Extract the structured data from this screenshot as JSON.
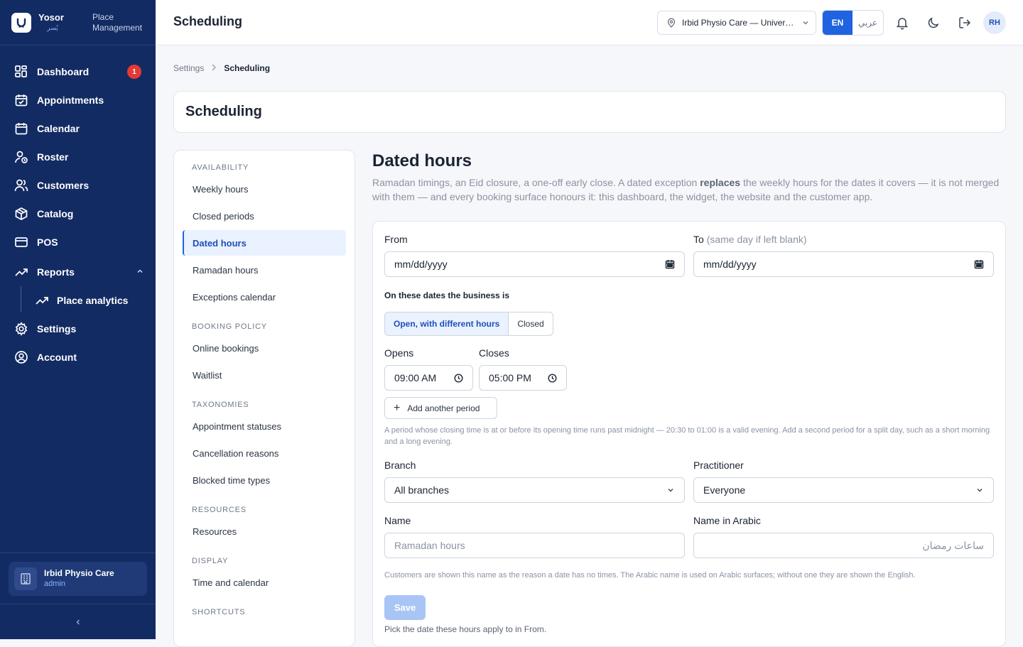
{
  "brand": {
    "name": "Yosor",
    "name_ar": "يُسر",
    "subtitle_line1": "Place",
    "subtitle_line2": "Management"
  },
  "nav": {
    "dashboard": "Dashboard",
    "dashboard_badge": "1",
    "appointments": "Appointments",
    "calendar": "Calendar",
    "roster": "Roster",
    "customers": "Customers",
    "catalog": "Catalog",
    "pos": "POS",
    "reports": "Reports",
    "place_analytics": "Place analytics",
    "settings": "Settings",
    "account": "Account"
  },
  "place_card": {
    "name": "Irbid Physio Care",
    "role": "admin"
  },
  "topbar": {
    "title": "Scheduling",
    "place_selector": "Irbid Physio Care — University Street",
    "lang_en": "EN",
    "lang_ar": "عربي",
    "avatar": "RH"
  },
  "breadcrumb": {
    "parent": "Settings",
    "current": "Scheduling"
  },
  "page_title": "Scheduling",
  "settings_menu": {
    "availability": "AVAILABILITY",
    "weekly_hours": "Weekly hours",
    "closed_periods": "Closed periods",
    "dated_hours": "Dated hours",
    "ramadan_hours": "Ramadan hours",
    "exceptions_calendar": "Exceptions calendar",
    "booking_policy": "BOOKING POLICY",
    "online_bookings": "Online bookings",
    "waitlist": "Waitlist",
    "taxonomies": "TAXONOMIES",
    "appointment_statuses": "Appointment statuses",
    "cancellation_reasons": "Cancellation reasons",
    "blocked_time_types": "Blocked time types",
    "resources_sec": "RESOURCES",
    "resources": "Resources",
    "display": "DISPLAY",
    "time_and_calendar": "Time and calendar",
    "shortcuts": "SHORTCUTS"
  },
  "content": {
    "heading": "Dated hours",
    "desc_before": "Ramadan timings, an Eid closure, a one-off early close. A dated exception ",
    "desc_bold": "replaces",
    "desc_after": " the weekly hours for the dates it covers — it is not merged with them — and every booking surface honours it: this dashboard, the widget, the website and the customer app."
  },
  "form": {
    "from_label": "From",
    "from_value": "mm/dd/yyyy",
    "to_label": "To",
    "to_hint": "(same day if left blank)",
    "to_value": "mm/dd/yyyy",
    "business_is_label": "On these dates the business is",
    "option_open": "Open, with different hours",
    "option_closed": "Closed",
    "opens_label": "Opens",
    "opens_value": "09:00 AM",
    "closes_label": "Closes",
    "closes_value": "05:00 PM",
    "add_period": "Add another period",
    "period_note": "A period whose closing time is at or before its opening time runs past midnight — 20:30 to 01:00 is a valid evening. Add a second period for a split day, such as a short morning and a long evening.",
    "branch_label": "Branch",
    "branch_value": "All branches",
    "practitioner_label": "Practitioner",
    "practitioner_value": "Everyone",
    "name_label": "Name",
    "name_placeholder": "Ramadan hours",
    "name_ar_label": "Name in Arabic",
    "name_ar_placeholder": "ساعات رمضان",
    "name_note": "Customers are shown this name as the reason a date has no times. The Arabic name is used on Arabic surfaces; without one they are shown the English.",
    "save": "Save",
    "save_hint": "Pick the date these hours apply to in From."
  },
  "colors": {
    "sidebar": "#132b63",
    "accent": "#1f63e0",
    "badge": "#e53935"
  }
}
